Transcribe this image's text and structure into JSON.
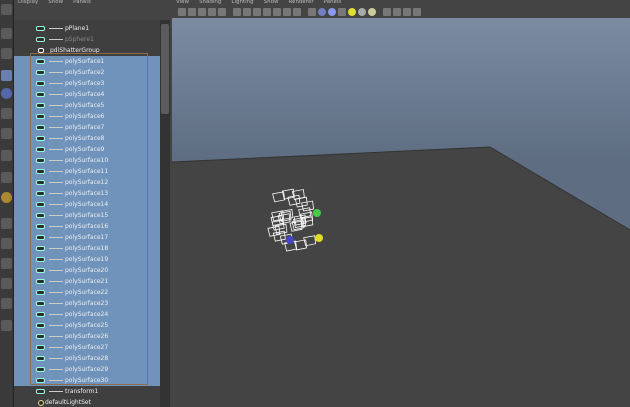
{
  "outliner": {
    "menu": [
      "Display",
      "Show",
      "Panels"
    ],
    "items": [
      {
        "label": "pPlane1",
        "type": "transform",
        "selected": false,
        "indent": 1
      },
      {
        "label": "pSphere1",
        "type": "transform",
        "selected": false,
        "indent": 1,
        "dim": true
      },
      {
        "label": "pdiShatterGroup",
        "type": "group",
        "selected": false,
        "indent": 0
      },
      {
        "label": "polySurface1",
        "type": "mesh",
        "selected": true,
        "indent": 1
      },
      {
        "label": "polySurface2",
        "type": "mesh",
        "selected": true,
        "indent": 1
      },
      {
        "label": "polySurface3",
        "type": "mesh",
        "selected": true,
        "indent": 1
      },
      {
        "label": "polySurface4",
        "type": "mesh",
        "selected": true,
        "indent": 1
      },
      {
        "label": "polySurface5",
        "type": "mesh",
        "selected": true,
        "indent": 1
      },
      {
        "label": "polySurface6",
        "type": "mesh",
        "selected": true,
        "indent": 1
      },
      {
        "label": "polySurface7",
        "type": "mesh",
        "selected": true,
        "indent": 1
      },
      {
        "label": "polySurface8",
        "type": "mesh",
        "selected": true,
        "indent": 1
      },
      {
        "label": "polySurface9",
        "type": "mesh",
        "selected": true,
        "indent": 1
      },
      {
        "label": "polySurface10",
        "type": "mesh",
        "selected": true,
        "indent": 1
      },
      {
        "label": "polySurface11",
        "type": "mesh",
        "selected": true,
        "indent": 1
      },
      {
        "label": "polySurface12",
        "type": "mesh",
        "selected": true,
        "indent": 1
      },
      {
        "label": "polySurface13",
        "type": "mesh",
        "selected": true,
        "indent": 1
      },
      {
        "label": "polySurface14",
        "type": "mesh",
        "selected": true,
        "indent": 1
      },
      {
        "label": "polySurface15",
        "type": "mesh",
        "selected": true,
        "indent": 1
      },
      {
        "label": "polySurface16",
        "type": "mesh",
        "selected": true,
        "indent": 1
      },
      {
        "label": "polySurface17",
        "type": "mesh",
        "selected": true,
        "indent": 1
      },
      {
        "label": "polySurface18",
        "type": "mesh",
        "selected": true,
        "indent": 1
      },
      {
        "label": "polySurface19",
        "type": "mesh",
        "selected": true,
        "indent": 1
      },
      {
        "label": "polySurface20",
        "type": "mesh",
        "selected": true,
        "indent": 1
      },
      {
        "label": "polySurface21",
        "type": "mesh",
        "selected": true,
        "indent": 1
      },
      {
        "label": "polySurface22",
        "type": "mesh",
        "selected": true,
        "indent": 1
      },
      {
        "label": "polySurface23",
        "type": "mesh",
        "selected": true,
        "indent": 1
      },
      {
        "label": "polySurface24",
        "type": "mesh",
        "selected": true,
        "indent": 1
      },
      {
        "label": "polySurface25",
        "type": "mesh",
        "selected": true,
        "indent": 1
      },
      {
        "label": "polySurface26",
        "type": "mesh",
        "selected": true,
        "indent": 1
      },
      {
        "label": "polySurface27",
        "type": "mesh",
        "selected": true,
        "indent": 1
      },
      {
        "label": "polySurface28",
        "type": "mesh",
        "selected": true,
        "indent": 1
      },
      {
        "label": "polySurface29",
        "type": "mesh",
        "selected": true,
        "indent": 1
      },
      {
        "label": "polySurface30",
        "type": "mesh",
        "selected": true,
        "indent": 1
      },
      {
        "label": "transform1",
        "type": "transform",
        "selected": false,
        "indent": 1
      },
      {
        "label": "defaultLightSet",
        "type": "set",
        "selected": false,
        "indent": 0
      }
    ]
  },
  "viewport": {
    "menu": [
      "View",
      "Shading",
      "Lighting",
      "Show",
      "Renderer",
      "Panels"
    ]
  },
  "colors": {
    "selection": "#7093bc",
    "sky": "#7f8fa6",
    "ground": "#444444"
  }
}
